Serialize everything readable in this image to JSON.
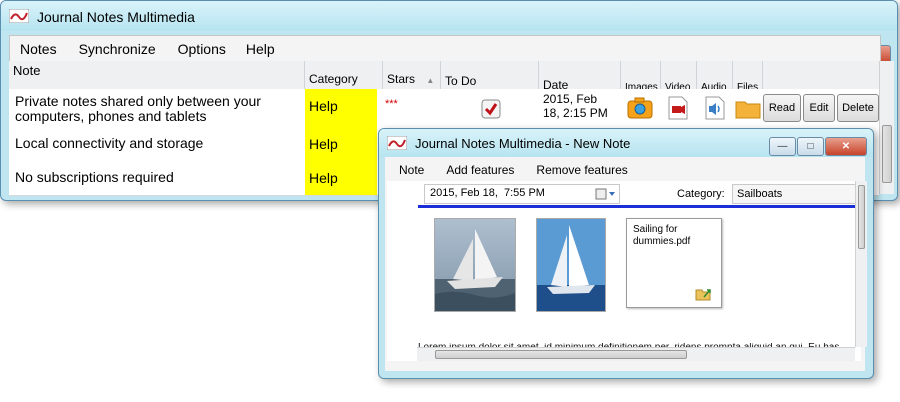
{
  "main_window": {
    "title": "Journal Notes Multimedia",
    "menu": [
      "Notes",
      "Synchronize",
      "Options",
      "Help"
    ],
    "columns": {
      "note": "Note",
      "category": "Category",
      "stars": "Stars",
      "todo": "To Do",
      "date": "Date",
      "images": "Images",
      "video": "Video",
      "audio": "Audio",
      "files": "Files"
    },
    "rows": [
      {
        "note": "Private notes shared only between your computers, phones and tablets",
        "category": "Help",
        "stars": "***",
        "date": "2015, Feb 18, 2:15 PM",
        "todo_checked": true
      },
      {
        "note": "Local connectivity and storage",
        "category": "Help"
      },
      {
        "note": "No subscriptions required",
        "category": "Help"
      }
    ],
    "actions": {
      "read": "Read",
      "edit": "Edit",
      "delete": "Delete"
    }
  },
  "new_note_window": {
    "title": "Journal Notes Multimedia - New Note",
    "menu": [
      "Note",
      "Add features",
      "Remove features"
    ],
    "date_value": "2015, Feb 18,  7:55 PM",
    "category_label": "Category:",
    "category_value": "Sailboats",
    "attachment_file": "Sailing for dummies.pdf",
    "body_text": "Lorem ipsum dolor sit amet, id minimum definitionem per, ridens prompta aliquid an qui. Eu has omnium ex vim et, ea eros euripidis scripserit cum. No ludus incorrupte vim, temporibus definitionem et pro."
  },
  "colors": {
    "category_highlight": "#ffff00",
    "accent_line": "#1a2fd6",
    "window_frame": "#bfe6f0"
  },
  "icons": [
    "app-logo-icon",
    "camera-icon",
    "video-icon",
    "speaker-icon",
    "folder-icon",
    "checkbox-checked-icon",
    "calendar-dropdown-icon",
    "sort-arrow-icon"
  ]
}
